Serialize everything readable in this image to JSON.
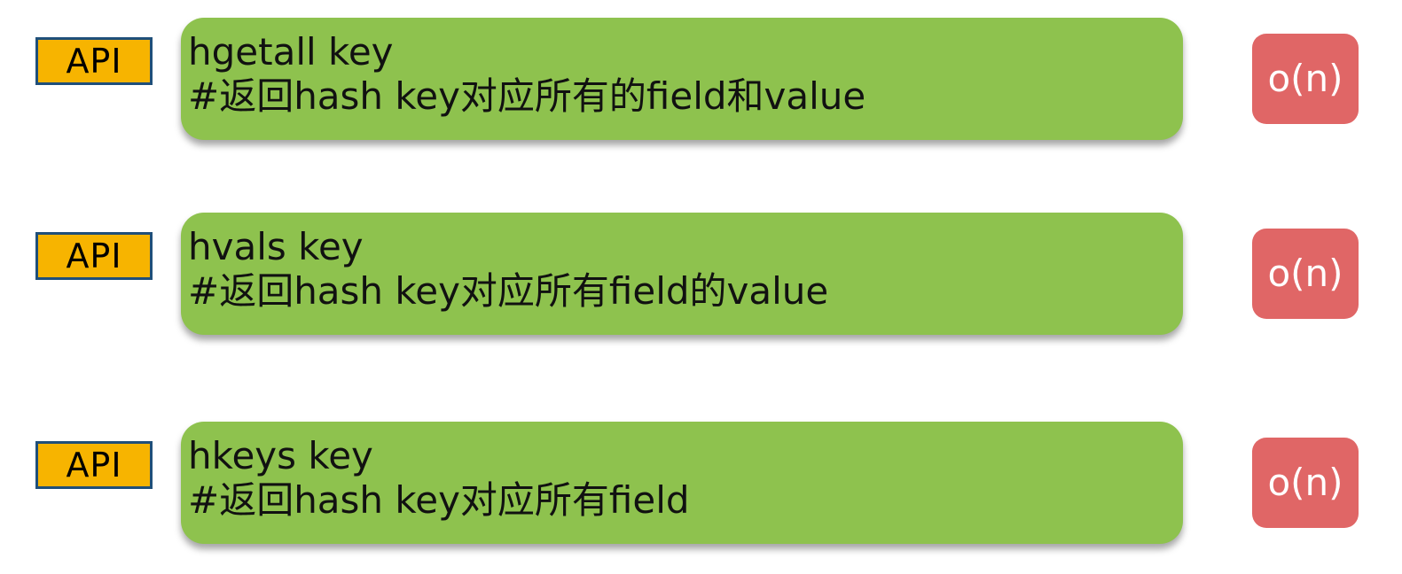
{
  "rows": [
    {
      "badge": "API",
      "command": "hgetall key",
      "description": "#返回hash key对应所有的field和value",
      "complexity": "o(n)"
    },
    {
      "badge": "API",
      "command": "hvals key",
      "description": "#返回hash key对应所有field的value",
      "complexity": "o(n)"
    },
    {
      "badge": "API",
      "command": "hkeys key",
      "description": "#返回hash key对应所有field",
      "complexity": "o(n)"
    }
  ],
  "colors": {
    "badge_fill": "#f7b400",
    "badge_border": "#1f4f7a",
    "command_box": "#8ec24e",
    "complexity_box": "#e06666"
  }
}
